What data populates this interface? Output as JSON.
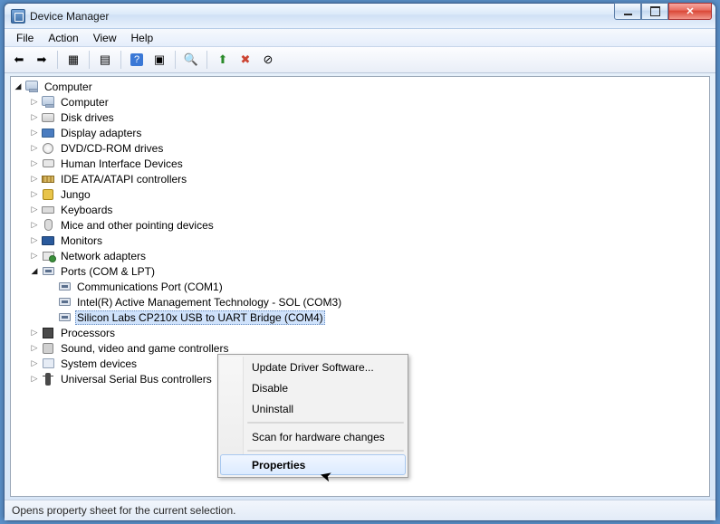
{
  "window": {
    "title": "Device Manager"
  },
  "menu": {
    "file": "File",
    "action": "Action",
    "view": "View",
    "help": "Help"
  },
  "toolbar": {
    "back": "Back",
    "forward": "Forward",
    "show_hidden": "Show hidden devices",
    "properties": "Properties",
    "help": "Help",
    "refresh": "Refresh",
    "scan": "Scan for hardware changes",
    "update": "Update Driver Software",
    "uninstall": "Uninstall",
    "disable": "Disable"
  },
  "tree": {
    "root": "Computer",
    "cat": {
      "computer": "Computer",
      "disk": "Disk drives",
      "display": "Display adapters",
      "dvd": "DVD/CD-ROM drives",
      "hid": "Human Interface Devices",
      "ide": "IDE ATA/ATAPI controllers",
      "jungo": "Jungo",
      "keyboards": "Keyboards",
      "mice": "Mice and other pointing devices",
      "monitors": "Monitors",
      "network": "Network adapters",
      "ports": "Ports (COM & LPT)",
      "processors": "Processors",
      "sound": "Sound, video and game controllers",
      "system": "System devices",
      "usb": "Universal Serial Bus controllers"
    },
    "ports_children": {
      "p0": "Communications Port (COM1)",
      "p1": "Intel(R) Active Management Technology - SOL (COM3)",
      "p2": "Silicon Labs CP210x USB to UART Bridge (COM4)"
    }
  },
  "context_menu": {
    "update": "Update Driver Software...",
    "disable": "Disable",
    "uninstall": "Uninstall",
    "scan": "Scan for hardware changes",
    "properties": "Properties"
  },
  "statusbar": {
    "text": "Opens property sheet for the current selection."
  }
}
